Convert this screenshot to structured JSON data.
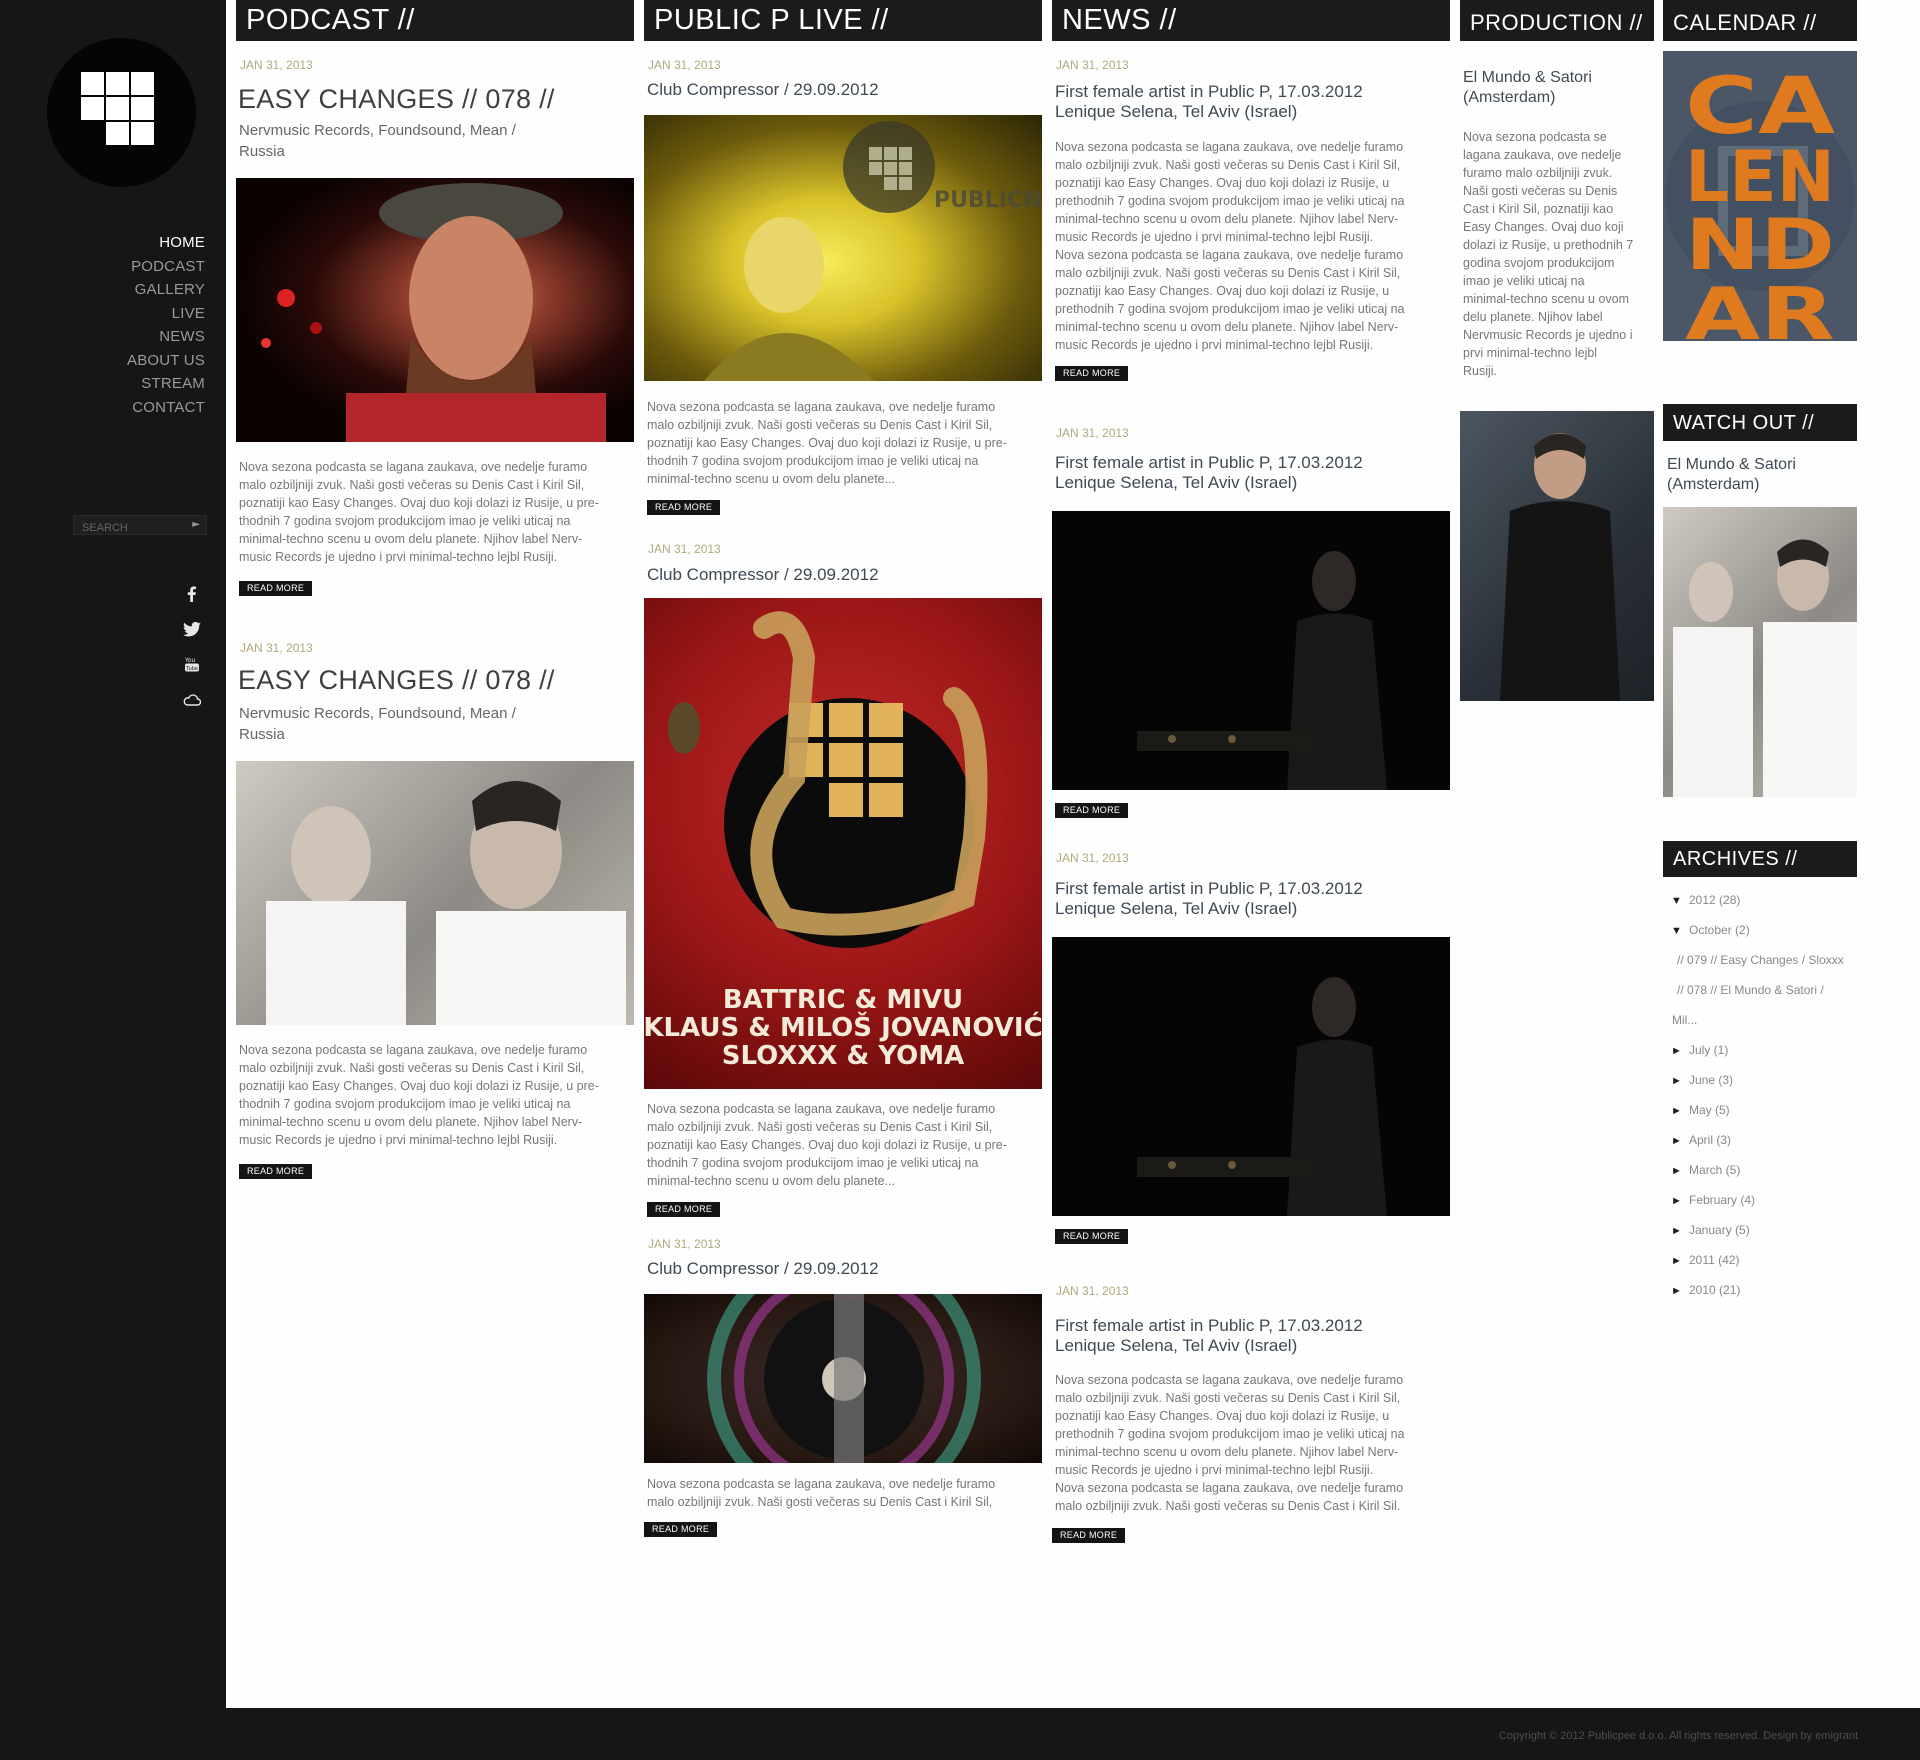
{
  "sidebar": {
    "nav": [
      "HOME",
      "PODCAST",
      "GALLERY",
      "LIVE",
      "NEWS",
      "ABOUT US",
      "STREAM",
      "CONTACT"
    ],
    "active_nav": "HOME",
    "search_placeholder": "SEARCH",
    "social_icons": [
      "facebook-icon",
      "twitter-icon",
      "youtube-icon",
      "soundcloud-icon"
    ]
  },
  "columns": {
    "podcast": {
      "heading": "PODCAST //"
    },
    "live": {
      "heading": "PUBLIC P LIVE //"
    },
    "news": {
      "heading": "NEWS //"
    },
    "production": {
      "heading": "PRODUCTION //"
    },
    "calendar": {
      "heading": "CALENDAR //"
    },
    "watchout": {
      "heading": "WATCH OUT //"
    },
    "archives": {
      "heading": "ARCHIVES //"
    }
  },
  "podcast_posts": [
    {
      "date": "JAN 31, 2013",
      "title": "EASY CHANGES // 078 //",
      "subtitle_1": "Nervmusic Records, Foundsound, Mean /",
      "subtitle_2": "Russia",
      "body": [
        "Nova sezona podcasta se lagana zaukava, ove nedelje furamo",
        "malo ozbiljniji zvuk. Naši gosti večeras su Denis Cast i Kiril Sil,",
        "poznatiji kao Easy Changes. Ovaj duo koji dolazi iz Rusije, u pre-",
        "thodnih 7 godina svojom produkcijom imao je veliki uticaj na",
        "minimal-techno scenu u ovom delu planete. Njihov label  Nerv-",
        "music Records je ujedno i prvi minimal-techno lejbl  Rusiji."
      ],
      "read_more": "READ MORE"
    },
    {
      "date": "JAN 31, 2013",
      "title": "EASY CHANGES // 078 //",
      "subtitle_1": "Nervmusic Records, Foundsound, Mean /",
      "subtitle_2": "Russia",
      "body": [
        "Nova sezona podcasta se lagana zaukava, ove nedelje furamo",
        "malo ozbiljniji zvuk. Naši gosti večeras su Denis Cast i Kiril Sil,",
        "poznatiji kao Easy Changes. Ovaj duo koji dolazi iz Rusije, u pre-",
        "thodnih 7 godina svojom produkcijom imao je veliki uticaj na",
        "minimal-techno scenu u ovom delu planete. Njihov label  Nerv-",
        "music Records je ujedno i prvi minimal-techno lejbl  Rusiji."
      ],
      "read_more": "READ MORE"
    }
  ],
  "live_posts": [
    {
      "date": "JAN 31, 2013",
      "title": "Club Compressor / 29.09.2012",
      "image_text": "PUBLICN",
      "body": [
        "Nova sezona podcasta se lagana zaukava, ove nedelje furamo",
        "malo ozbiljniji zvuk. Naši gosti večeras su Denis Cast i Kiril Sil,",
        "poznatiji kao Easy Changes. Ovaj duo koji dolazi iz Rusije, u pre-",
        "thodnih 7 godina svojom produkcijom imao je veliki uticaj na",
        "minimal-techno scenu u ovom delu planete..."
      ],
      "read_more": "READ MORE"
    },
    {
      "date": "JAN 31, 2013",
      "title": "Club Compressor / 29.09.2012",
      "poster_lines": [
        "BATTRIC & MIVU",
        "KLAUS & MILOŠ JOVANOVIĆ",
        "SLOXXX & YOMA"
      ],
      "body": [
        "Nova sezona podcasta se lagana zaukava, ove nedelje furamo",
        "malo ozbiljniji zvuk. Naši gosti večeras su Denis Cast i Kiril Sil,",
        "poznatiji kao Easy Changes. Ovaj duo koji dolazi iz Rusije, u pre-",
        "thodnih 7 godina svojom produkcijom imao je veliki uticaj na",
        "minimal-techno scenu u ovom delu planete..."
      ],
      "read_more": "READ MORE"
    },
    {
      "date": "JAN 31, 2013",
      "title": "Club Compressor / 29.09.2012",
      "body": [
        "Nova sezona podcasta se lagana zaukava, ove nedelje furamo",
        "malo ozbiljniji zvuk. Naši gosti večeras su Denis Cast i Kiril Sil,"
      ],
      "read_more": "READ MORE"
    }
  ],
  "news_posts": [
    {
      "date": "JAN 31, 2013",
      "title_1": "First female artist in Public P, 17.03.2012",
      "title_2": "Lenique Selena, Tel Aviv (Israel)",
      "body": [
        "Nova sezona podcasta se lagana zaukava, ove nedelje furamo",
        "malo ozbiljniji zvuk. Naši gosti večeras su Denis Cast i Kiril Sil,",
        "poznatiji kao Easy Changes. Ovaj duo koji dolazi iz Rusije, u",
        "prethodnih 7 godina svojom produkcijom imao je veliki uticaj na",
        "minimal-techno scenu u ovom delu planete. Njihov label  Nerv-",
        "music Records je ujedno i prvi minimal-techno lejbl  Rusiji.",
        "Nova sezona podcasta se lagana zaukava, ove nedelje furamo",
        "malo ozbiljniji zvuk. Naši gosti večeras su Denis Cast i Kiril Sil,",
        "poznatiji kao Easy Changes. Ovaj duo koji dolazi iz Rusije, u",
        "prethodnih 7 godina svojom produkcijom imao je veliki uticaj na",
        "minimal-techno scenu u ovom delu planete. Njihov label  Nerv-",
        "music Records je ujedno i prvi minimal-techno lejbl  Rusiji."
      ],
      "read_more": "READ MORE"
    },
    {
      "date": "JAN 31, 2013",
      "title_1": "First female artist in Public P, 17.03.2012",
      "title_2": "Lenique Selena, Tel Aviv (Israel)",
      "read_more": "READ MORE"
    },
    {
      "date": "JAN 31, 2013",
      "title_1": "First female artist in Public P, 17.03.2012",
      "title_2": "Lenique Selena, Tel Aviv (Israel)",
      "read_more": "READ MORE"
    },
    {
      "date": "JAN 31, 2013",
      "title_1": "First female artist in Public P, 17.03.2012",
      "title_2": "Lenique Selena, Tel Aviv (Israel)",
      "body": [
        "Nova sezona podcasta se lagana zaukava, ove nedelje furamo",
        "malo ozbiljniji zvuk. Naši gosti večeras su Denis Cast i Kiril Sil,",
        "poznatiji kao Easy Changes. Ovaj duo koji dolazi iz Rusije, u",
        "prethodnih 7 godina svojom produkcijom imao je veliki uticaj na",
        "minimal-techno scenu u ovom delu planete. Njihov label  Nerv-",
        "music Records je ujedno i prvi minimal-techno lejbl  Rusiji.",
        "Nova sezona podcasta se lagana zaukava, ove nedelje furamo",
        "malo ozbiljniji zvuk. Naši gosti večeras su Denis Cast i Kiril Sil."
      ],
      "read_more": "READ MORE"
    }
  ],
  "production": {
    "title_1": "El Mundo & Satori",
    "title_2": "(Amsterdam)",
    "body": [
      "Nova sezona podcasta se",
      "lagana zaukava, ove nedelje",
      "furamo malo ozbiljniji zvuk.",
      "Naši gosti večeras su Denis",
      "Cast i Kiril Sil, poznatiji kao",
      "Easy Changes. Ovaj duo koji",
      "dolazi iz Rusije, u prethodnih 7",
      "godina svojom produkcijom",
      "imao je veliki uticaj na",
      "minimal-techno scenu u ovom",
      "delu planete. Njihov label",
      "Nervmusic Records je ujedno i",
      "prvi minimal-techno lejbl",
      "Rusiji."
    ]
  },
  "calendar": {
    "poster_lines": [
      "CA",
      "LEN",
      "ND",
      "AR"
    ]
  },
  "watchout": {
    "title_1": "El Mundo & Satori",
    "title_2": "(Amsterdam)"
  },
  "archives": [
    {
      "label": "2012 (28)",
      "marker": "▼",
      "indent": 0
    },
    {
      "label": "October (2)",
      "marker": "▼",
      "indent": 0
    },
    {
      "label": "// 079 // Easy Changes / Sloxxx",
      "marker": "",
      "indent": 1
    },
    {
      "label": "// 078 // El Mundo & Satori /",
      "marker": "",
      "indent": 1
    },
    {
      "label": "Mil...",
      "marker": "",
      "indent": 2
    },
    {
      "label": "July (1)",
      "marker": "►",
      "indent": 0
    },
    {
      "label": "June (3)",
      "marker": "►",
      "indent": 0
    },
    {
      "label": "May (5)",
      "marker": "►",
      "indent": 0
    },
    {
      "label": "April (3)",
      "marker": "►",
      "indent": 0
    },
    {
      "label": "March (5)",
      "marker": "►",
      "indent": 0
    },
    {
      "label": "February (4)",
      "marker": "►",
      "indent": 0
    },
    {
      "label": "January (5)",
      "marker": "►",
      "indent": 0
    },
    {
      "label": "2011 (42)",
      "marker": "►",
      "indent": 0
    },
    {
      "label": "2010 (21)",
      "marker": "►",
      "indent": 0
    }
  ],
  "footer": {
    "copyright": "Copyright © 2012 Publicpee d.o.o. All rights reserved. Design by emigrant"
  },
  "colors": {
    "sidebar_bg": "#161616",
    "header_bg": "#1b1b1b",
    "date": "#b1a97a",
    "accent_orange": "#e07a1f"
  }
}
